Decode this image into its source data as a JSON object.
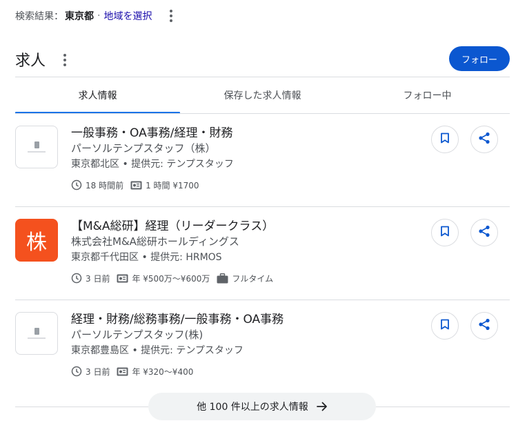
{
  "location_bar": {
    "prefix": "検索結果：",
    "city": "東京都",
    "separator": "·",
    "link": "地域を選択"
  },
  "header": {
    "title": "求人",
    "follow_button": "フォロー"
  },
  "tabs": [
    {
      "label": "求人情報",
      "active": true
    },
    {
      "label": "保存した求人情報",
      "active": false
    },
    {
      "label": "フォロー中",
      "active": false
    }
  ],
  "jobs": [
    {
      "logo": "placeholder-logo",
      "title": "一般事務・OA事務/経理・財務",
      "company": "パーソルテンプスタッフ（株）",
      "location": "東京都北区 • 提供元: テンプスタッフ",
      "posted": "18 時間前",
      "salary": "1 時間 ¥1700",
      "job_type": ""
    },
    {
      "logo": "株",
      "title": "【M&A総研】経理（リーダークラス）",
      "company": "株式会社M&A総研ホールディングス",
      "location": "東京都千代田区 • 提供元: HRMOS",
      "posted": "3 日前",
      "salary": "年 ¥500万～¥600万",
      "job_type": "フルタイム"
    },
    {
      "logo": "placeholder-logo",
      "title": "経理・財務/総務事務/一般事務・OA事務",
      "company": "パーソルテンプスタッフ(株)",
      "location": "東京都豊島区 • 提供元: テンプスタッフ",
      "posted": "3 日前",
      "salary": "年 ¥320～¥400",
      "job_type": ""
    }
  ],
  "more_button": "他 100 件以上の求人情報",
  "colors": {
    "accent": "#0b57d0",
    "tab_indicator": "#1a73e8",
    "company_logo_bg": "#f4511e",
    "link": "#1a0dab"
  },
  "icons": {
    "menu": "more-vert-icon",
    "save": "bookmark-icon",
    "share": "share-icon",
    "time": "clock-icon",
    "salary": "money-icon",
    "job_type": "briefcase-icon",
    "more": "arrow-right-icon"
  }
}
